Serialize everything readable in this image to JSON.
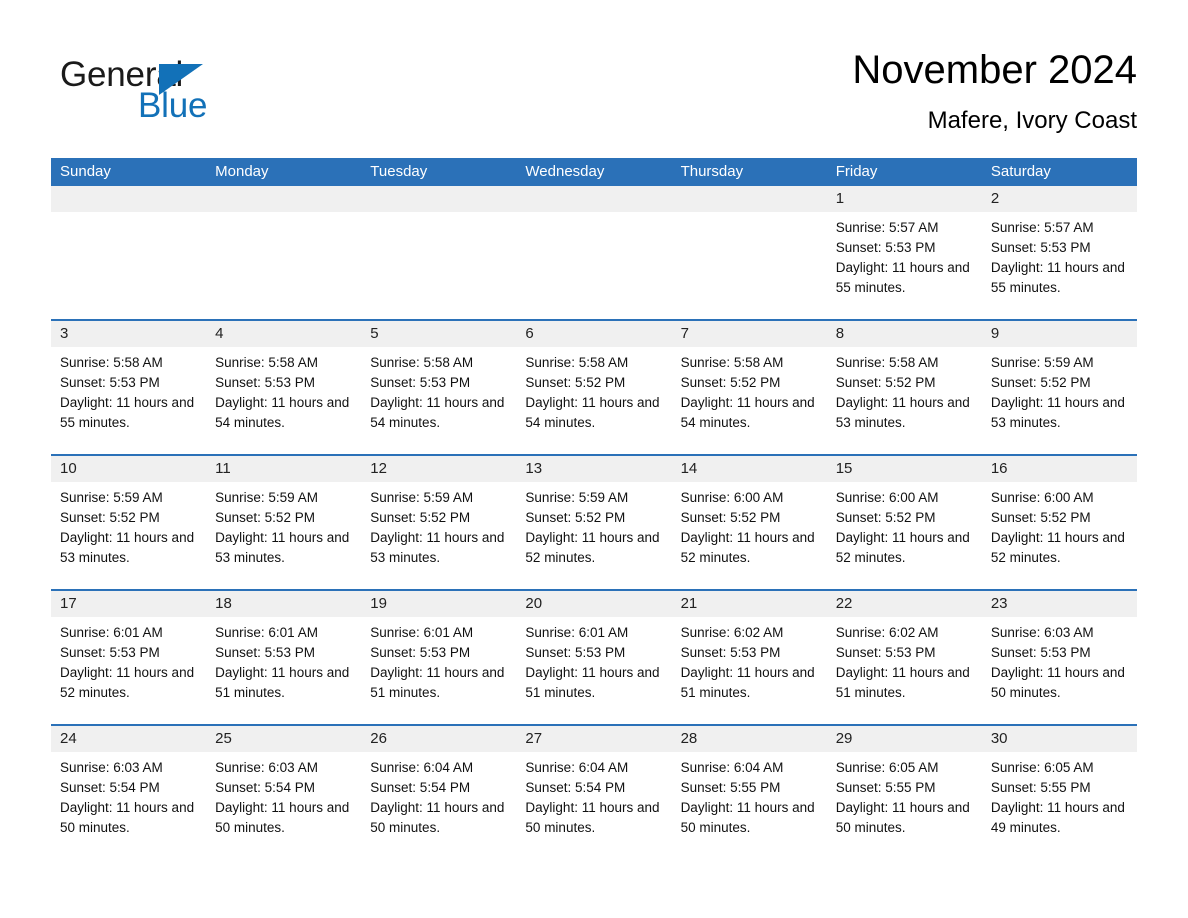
{
  "brand": {
    "name_part1": "General",
    "name_part2": "Blue",
    "logo_icon": "triangle-icon",
    "accent_color": "#1271b8"
  },
  "header": {
    "title": "November 2024",
    "subtitle": "Mafere, Ivory Coast"
  },
  "colors": {
    "header_blue": "#2b71b8",
    "day_band_gray": "#f0f0f0",
    "row_divider_blue": "#2b71b8"
  },
  "weekdays": [
    "Sunday",
    "Monday",
    "Tuesday",
    "Wednesday",
    "Thursday",
    "Friday",
    "Saturday"
  ],
  "labels": {
    "sunrise": "Sunrise:",
    "sunset": "Sunset:",
    "daylight": "Daylight:"
  },
  "weeks": [
    [
      {
        "day": ""
      },
      {
        "day": ""
      },
      {
        "day": ""
      },
      {
        "day": ""
      },
      {
        "day": ""
      },
      {
        "day": "1",
        "sunrise": "Sunrise: 5:57 AM",
        "sunset": "Sunset: 5:53 PM",
        "daylight": "Daylight: 11 hours and 55 minutes."
      },
      {
        "day": "2",
        "sunrise": "Sunrise: 5:57 AM",
        "sunset": "Sunset: 5:53 PM",
        "daylight": "Daylight: 11 hours and 55 minutes."
      }
    ],
    [
      {
        "day": "3",
        "sunrise": "Sunrise: 5:58 AM",
        "sunset": "Sunset: 5:53 PM",
        "daylight": "Daylight: 11 hours and 55 minutes."
      },
      {
        "day": "4",
        "sunrise": "Sunrise: 5:58 AM",
        "sunset": "Sunset: 5:53 PM",
        "daylight": "Daylight: 11 hours and 54 minutes."
      },
      {
        "day": "5",
        "sunrise": "Sunrise: 5:58 AM",
        "sunset": "Sunset: 5:53 PM",
        "daylight": "Daylight: 11 hours and 54 minutes."
      },
      {
        "day": "6",
        "sunrise": "Sunrise: 5:58 AM",
        "sunset": "Sunset: 5:52 PM",
        "daylight": "Daylight: 11 hours and 54 minutes."
      },
      {
        "day": "7",
        "sunrise": "Sunrise: 5:58 AM",
        "sunset": "Sunset: 5:52 PM",
        "daylight": "Daylight: 11 hours and 54 minutes."
      },
      {
        "day": "8",
        "sunrise": "Sunrise: 5:58 AM",
        "sunset": "Sunset: 5:52 PM",
        "daylight": "Daylight: 11 hours and 53 minutes."
      },
      {
        "day": "9",
        "sunrise": "Sunrise: 5:59 AM",
        "sunset": "Sunset: 5:52 PM",
        "daylight": "Daylight: 11 hours and 53 minutes."
      }
    ],
    [
      {
        "day": "10",
        "sunrise": "Sunrise: 5:59 AM",
        "sunset": "Sunset: 5:52 PM",
        "daylight": "Daylight: 11 hours and 53 minutes."
      },
      {
        "day": "11",
        "sunrise": "Sunrise: 5:59 AM",
        "sunset": "Sunset: 5:52 PM",
        "daylight": "Daylight: 11 hours and 53 minutes."
      },
      {
        "day": "12",
        "sunrise": "Sunrise: 5:59 AM",
        "sunset": "Sunset: 5:52 PM",
        "daylight": "Daylight: 11 hours and 53 minutes."
      },
      {
        "day": "13",
        "sunrise": "Sunrise: 5:59 AM",
        "sunset": "Sunset: 5:52 PM",
        "daylight": "Daylight: 11 hours and 52 minutes."
      },
      {
        "day": "14",
        "sunrise": "Sunrise: 6:00 AM",
        "sunset": "Sunset: 5:52 PM",
        "daylight": "Daylight: 11 hours and 52 minutes."
      },
      {
        "day": "15",
        "sunrise": "Sunrise: 6:00 AM",
        "sunset": "Sunset: 5:52 PM",
        "daylight": "Daylight: 11 hours and 52 minutes."
      },
      {
        "day": "16",
        "sunrise": "Sunrise: 6:00 AM",
        "sunset": "Sunset: 5:52 PM",
        "daylight": "Daylight: 11 hours and 52 minutes."
      }
    ],
    [
      {
        "day": "17",
        "sunrise": "Sunrise: 6:01 AM",
        "sunset": "Sunset: 5:53 PM",
        "daylight": "Daylight: 11 hours and 52 minutes."
      },
      {
        "day": "18",
        "sunrise": "Sunrise: 6:01 AM",
        "sunset": "Sunset: 5:53 PM",
        "daylight": "Daylight: 11 hours and 51 minutes."
      },
      {
        "day": "19",
        "sunrise": "Sunrise: 6:01 AM",
        "sunset": "Sunset: 5:53 PM",
        "daylight": "Daylight: 11 hours and 51 minutes."
      },
      {
        "day": "20",
        "sunrise": "Sunrise: 6:01 AM",
        "sunset": "Sunset: 5:53 PM",
        "daylight": "Daylight: 11 hours and 51 minutes."
      },
      {
        "day": "21",
        "sunrise": "Sunrise: 6:02 AM",
        "sunset": "Sunset: 5:53 PM",
        "daylight": "Daylight: 11 hours and 51 minutes."
      },
      {
        "day": "22",
        "sunrise": "Sunrise: 6:02 AM",
        "sunset": "Sunset: 5:53 PM",
        "daylight": "Daylight: 11 hours and 51 minutes."
      },
      {
        "day": "23",
        "sunrise": "Sunrise: 6:03 AM",
        "sunset": "Sunset: 5:53 PM",
        "daylight": "Daylight: 11 hours and 50 minutes."
      }
    ],
    [
      {
        "day": "24",
        "sunrise": "Sunrise: 6:03 AM",
        "sunset": "Sunset: 5:54 PM",
        "daylight": "Daylight: 11 hours and 50 minutes."
      },
      {
        "day": "25",
        "sunrise": "Sunrise: 6:03 AM",
        "sunset": "Sunset: 5:54 PM",
        "daylight": "Daylight: 11 hours and 50 minutes."
      },
      {
        "day": "26",
        "sunrise": "Sunrise: 6:04 AM",
        "sunset": "Sunset: 5:54 PM",
        "daylight": "Daylight: 11 hours and 50 minutes."
      },
      {
        "day": "27",
        "sunrise": "Sunrise: 6:04 AM",
        "sunset": "Sunset: 5:54 PM",
        "daylight": "Daylight: 11 hours and 50 minutes."
      },
      {
        "day": "28",
        "sunrise": "Sunrise: 6:04 AM",
        "sunset": "Sunset: 5:55 PM",
        "daylight": "Daylight: 11 hours and 50 minutes."
      },
      {
        "day": "29",
        "sunrise": "Sunrise: 6:05 AM",
        "sunset": "Sunset: 5:55 PM",
        "daylight": "Daylight: 11 hours and 50 minutes."
      },
      {
        "day": "30",
        "sunrise": "Sunrise: 6:05 AM",
        "sunset": "Sunset: 5:55 PM",
        "daylight": "Daylight: 11 hours and 49 minutes."
      }
    ]
  ]
}
